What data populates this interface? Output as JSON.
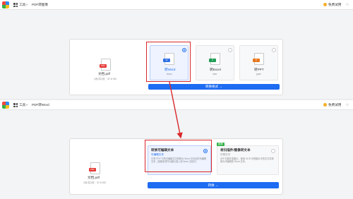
{
  "app": {
    "logo": "app-logo-icon",
    "tool_label": "工具",
    "upgrade_label": "免费试用"
  },
  "shot1": {
    "page_title": "PDF转图像",
    "file": {
      "name": "文档.pdf",
      "meta": "1页/共1页 · 37.6 KB",
      "badge": "PDF"
    },
    "options": [
      {
        "label": "转Word",
        "sub": "docx",
        "badge": "W",
        "color": "#2f6fe5",
        "selected": true
      },
      {
        "label": "转Excel",
        "sub": "xlsx",
        "badge": "X",
        "color": "#1f9d55",
        "selected": false
      },
      {
        "label": "转PPT",
        "sub": "pptx",
        "badge": "P",
        "color": "#e8761d",
        "selected": false
      }
    ],
    "action_label": "转换格式 →"
  },
  "shot2": {
    "page_title": "PDF转Word",
    "file": {
      "name": "文档.pdf",
      "meta": "1页/共1页 · 37.6 KB",
      "badge": "PDF"
    },
    "modes": [
      {
        "title": "转换可编辑文本",
        "sub": "可编辑文本",
        "desc": "已有 PDF 中的可编辑文字转换为 Word 中对应的可编辑文本，图像依然作为图片插入到 Word 文档中。",
        "selected": true
      },
      {
        "title": "将扫描件/图像转文本",
        "sub": "识别文字",
        "desc": "对于扫描件或图片，使用 OCR 识别图片中的文字并转换为可编辑的 Word 文本。",
        "selected": false,
        "badge": "推荐"
      }
    ],
    "action_label": "转换 →"
  },
  "colors": {
    "accent": "#1d6cf2",
    "highlight": "#d8282b",
    "pdf_red": "#e53935"
  }
}
